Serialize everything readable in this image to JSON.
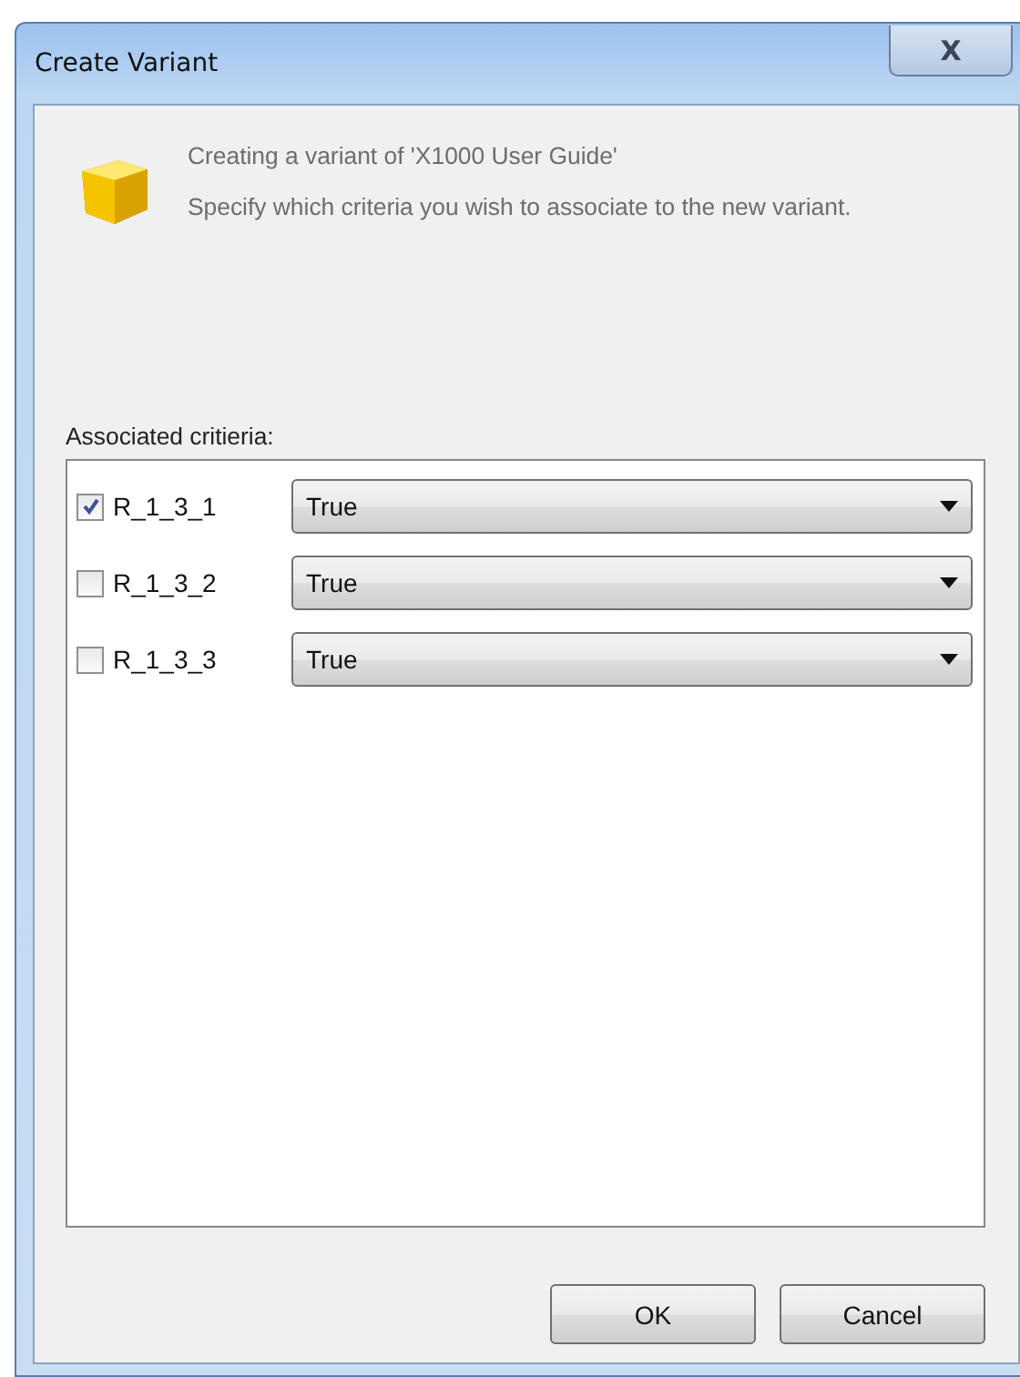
{
  "window": {
    "title": "Create Variant",
    "close": "X"
  },
  "header": {
    "title": "Creating a variant of 'X1000 User Guide'",
    "description": "Specify which criteria you wish to associate to the new variant."
  },
  "criteria_label": "Associated critieria:",
  "criteria": [
    {
      "name": "R_1_3_1",
      "checked": true,
      "value": "True"
    },
    {
      "name": "R_1_3_2",
      "checked": false,
      "value": "True"
    },
    {
      "name": "R_1_3_3",
      "checked": false,
      "value": "True"
    }
  ],
  "buttons": [
    {
      "label": "OK"
    },
    {
      "label": "Cancel"
    }
  ]
}
